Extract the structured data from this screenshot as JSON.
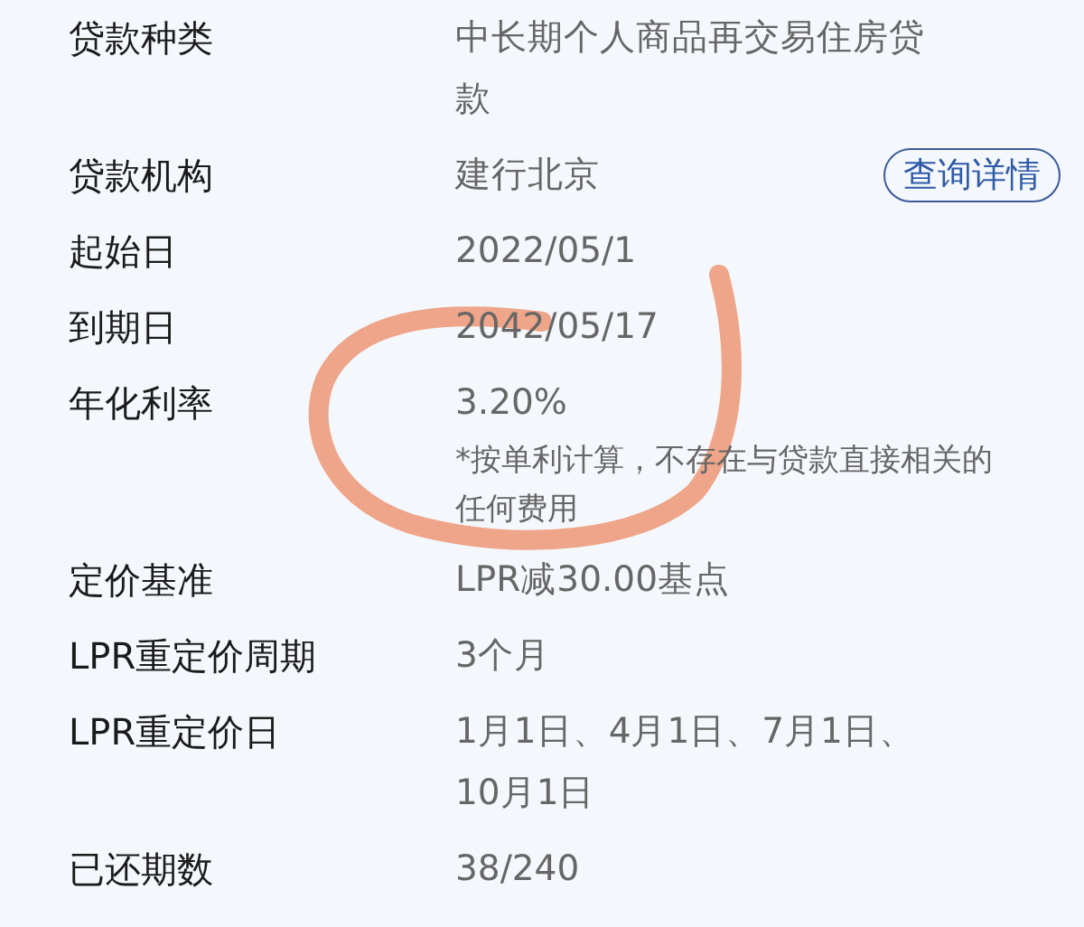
{
  "rows": [
    {
      "label": "贷款种类",
      "value": "中长期个人商品再交易住房贷款"
    },
    {
      "label": "贷款机构",
      "value": "建行北京",
      "button": "查询详情"
    },
    {
      "label": "起始日",
      "value": "2022/05/1"
    },
    {
      "label": "到期日",
      "value": "2042/05/17"
    },
    {
      "label": "年化利率",
      "value": "3.20%",
      "note": "*按单利计算，不存在与贷款直接相关的任何费用"
    },
    {
      "label": "定价基准",
      "value": "LPR减30.00基点"
    },
    {
      "label": "LPR重定价周期",
      "value": "3个月"
    },
    {
      "label": "LPR重定价日",
      "value": "1月1日、4月1日、7月1日、10月1日"
    },
    {
      "label": "已还期数",
      "value": "38/240"
    }
  ]
}
